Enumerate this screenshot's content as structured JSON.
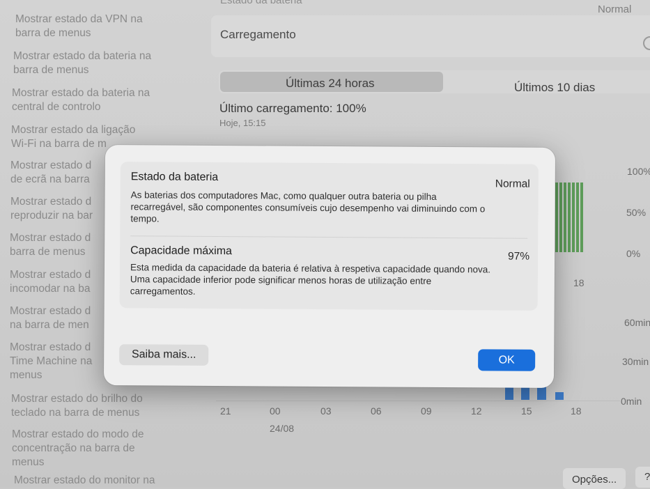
{
  "sidebar": {
    "items": [
      "Mostrar estado da VPN na\nbarra de menus",
      "Mostrar estado da bateria na\nbarra de menus",
      "Mostrar estado da bateria na\ncentral de controlo",
      "Mostrar estado da ligação\nWi-Fi na barra de m",
      "Mostrar estado d\nde ecrã na barra",
      "Mostrar estado d\nreproduzir na bar",
      "Mostrar estado d\nbarra de menus",
      "Mostrar estado d\nincomodar na ba",
      "Mostrar estado d\nna barra de men",
      "Mostrar estado d\nTime Machine na\nmenus",
      "Mostrar estado do brilho do\nteclado na barra de menus",
      "Mostrar estado do modo de\nconcentração na barra de\nmenus",
      "Mostrar estado do monitor na"
    ]
  },
  "background": {
    "top_label": "Estado da bateria",
    "normal": "Normal",
    "charging": "Carregamento",
    "segment_left": "Últimas 24 horas",
    "segment_right": "Últimos 10 dias",
    "last_charge": "Último carregamento: 100%",
    "last_time": "Hoje, 15:15",
    "pct_100": "100%",
    "pct_50": "50%",
    "pct_0": "0%",
    "min_60": "60min",
    "min_30": "30min",
    "min_0": "0min",
    "tick_mid_18": "18",
    "xticks": [
      "21",
      "00",
      "03",
      "06",
      "09",
      "12",
      "15",
      "18"
    ],
    "date": "24/08",
    "options_button": "Opções...",
    "help_button": "?"
  },
  "dialog": {
    "battery_state_title": "Estado da bateria",
    "battery_state_value": "Normal",
    "battery_state_desc": "As baterias dos computadores Mac, como qualquer outra bateria ou pilha recarregável, são componentes consumíveis cujo desempenho vai diminuindo com o tempo.",
    "capacity_title": "Capacidade máxima",
    "capacity_value": "97%",
    "capacity_desc": "Esta medida da capacidade da bateria é relativa à respetiva capacidade quando nova. Uma capacidade inferior pode significar menos horas de utilização entre carregamentos.",
    "learn_more_button": "Saiba mais...",
    "ok_button": "OK"
  },
  "colors": {
    "ok_button": "#1a6fdc",
    "battery_bar": "#5e9d5a",
    "usage_bar": "#3c79c4"
  }
}
